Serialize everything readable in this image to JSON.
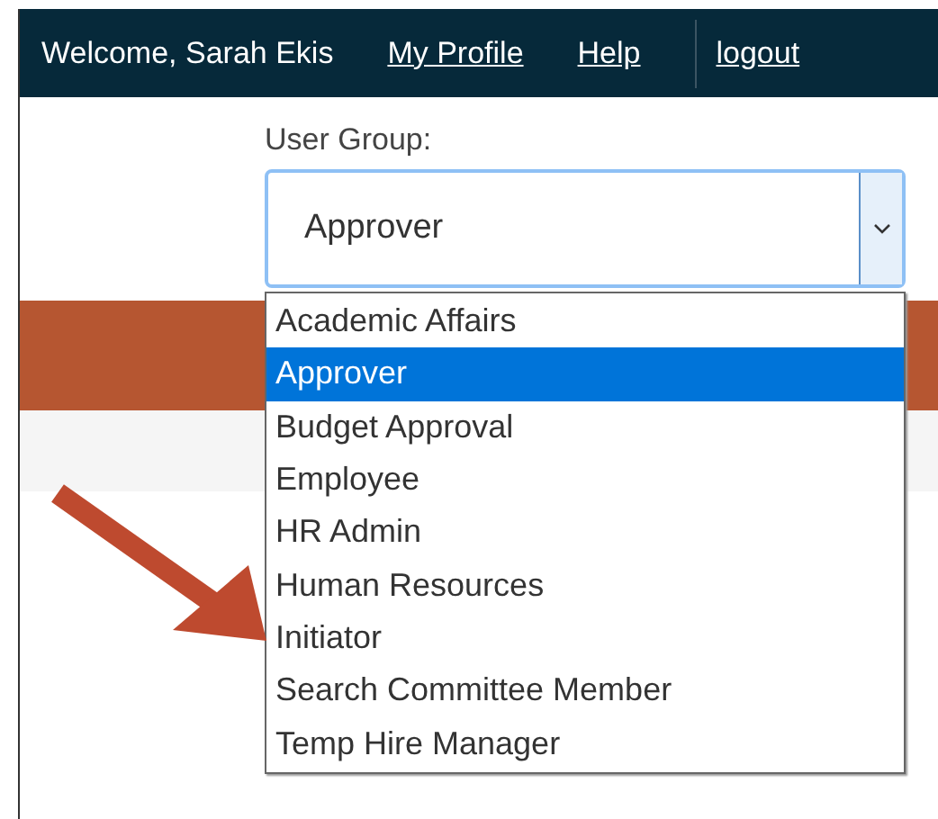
{
  "header": {
    "welcome": "Welcome, Sarah Ekis",
    "links": [
      "My Profile",
      "Help",
      "logout"
    ]
  },
  "user_group": {
    "label": "User Group:",
    "value": "Approver",
    "expanded": true,
    "options": [
      {
        "label": "Academic Affairs",
        "selected": false
      },
      {
        "label": "Approver",
        "selected": true
      },
      {
        "label": "Budget Approval",
        "selected": false
      },
      {
        "label": "Employee",
        "selected": false
      },
      {
        "label": "HR Admin",
        "selected": false
      },
      {
        "label": "Human Resources",
        "selected": false
      },
      {
        "label": "Initiator",
        "selected": false
      },
      {
        "label": "Search Committee Member",
        "selected": false
      },
      {
        "label": "Temp Hire Manager",
        "selected": false
      }
    ]
  }
}
